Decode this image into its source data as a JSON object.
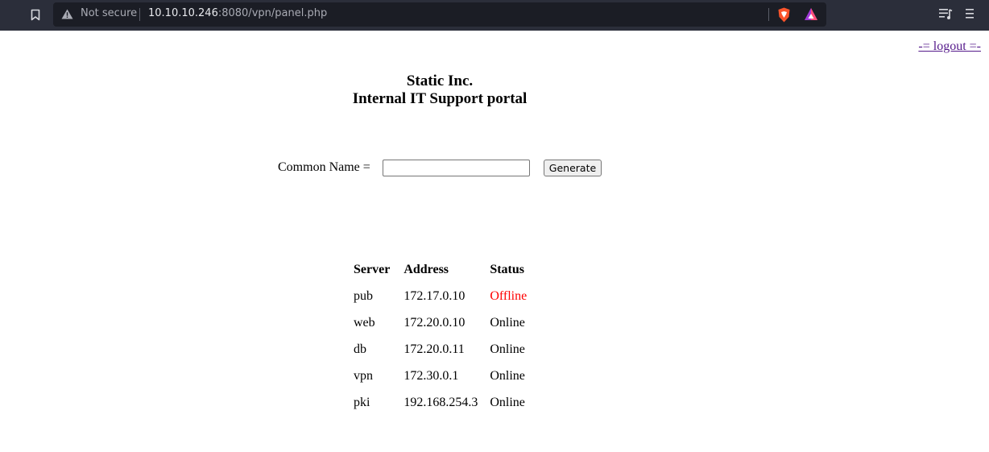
{
  "browser": {
    "security_label": "Not secure",
    "url_host": "10.10.10.246",
    "url_rest": ":8080/vpn/panel.php"
  },
  "page": {
    "logout_label": "-= logout =-",
    "title_line1": "Static Inc.",
    "title_line2": "Internal IT Support portal",
    "common_name_label": "Common Name =",
    "common_name_value": "",
    "generate_label": "Generate"
  },
  "table": {
    "headers": [
      "Server",
      "Address",
      "Status"
    ],
    "rows": [
      {
        "server": "pub",
        "address": "172.17.0.10",
        "status": "Offline"
      },
      {
        "server": "web",
        "address": "172.20.0.10",
        "status": "Online"
      },
      {
        "server": "db",
        "address": "172.20.0.11",
        "status": "Online"
      },
      {
        "server": "vpn",
        "address": "172.30.0.1",
        "status": "Online"
      },
      {
        "server": "pki",
        "address": "192.168.254.3",
        "status": "Online"
      }
    ]
  },
  "colors": {
    "offline": "#ff0000",
    "toolbar_bg": "#2b2e3a",
    "urlbar_bg": "#1b1d25"
  },
  "icons": [
    "bookmark-icon",
    "warning-icon",
    "brave-shield-icon",
    "brave-rewards-icon",
    "playlist-icon",
    "menu-icon"
  ]
}
